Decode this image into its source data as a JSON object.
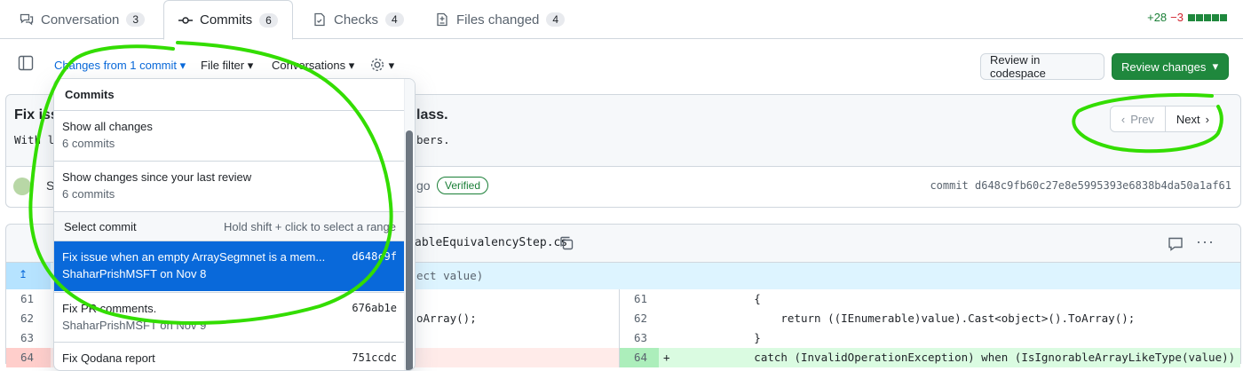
{
  "tabs": [
    {
      "label": "Conversation",
      "count": "3"
    },
    {
      "label": "Commits",
      "count": "6"
    },
    {
      "label": "Checks",
      "count": "4"
    },
    {
      "label": "Files changed",
      "count": "4"
    }
  ],
  "diffstat": {
    "additions": "+28",
    "deletions": "−3"
  },
  "toolbar": {
    "changes_prefix": "Changes from ",
    "changes_link": "1 commit",
    "file_filter": "File filter",
    "conversations": "Conversations",
    "review_codespace": "Review in codespace",
    "review_changes": "Review changes"
  },
  "commit_card": {
    "title_start": "Fix iss",
    "title_end": "lass.",
    "body_start": "With l",
    "body_end": "bers.",
    "author_initial": "S",
    "time_tail": "go",
    "verified": "Verified",
    "commit_sha": "commit d648c9fb60c27e8e5995393e6838b4da50a1af61",
    "prev": "Prev",
    "next": "Next"
  },
  "file_header": {
    "filename_tail": "ableEquivalencyStep.cs"
  },
  "diff": {
    "hunk_tail": "ect value)",
    "left_lines": [
      {
        "num": "61",
        "code": ""
      },
      {
        "num": "62",
        "code": "oArray();"
      },
      {
        "num": "63",
        "code": ""
      },
      {
        "num": "64",
        "code": ""
      }
    ],
    "right_lines": [
      {
        "num": "61",
        "marker": "",
        "code": "            {"
      },
      {
        "num": "62",
        "marker": "",
        "code": "                return ((IEnumerable)value).Cast<object>().ToArray();"
      },
      {
        "num": "63",
        "marker": "",
        "code": "            }"
      },
      {
        "num": "64",
        "marker": "+",
        "code": "            catch (InvalidOperationException) when (IsIgnorableArrayLikeType(value))"
      }
    ]
  },
  "dropdown": {
    "header": "Commits",
    "show_all_title": "Show all changes",
    "show_all_sub": "6 commits",
    "since_review_title": "Show changes since your last review",
    "since_review_sub": "6 commits",
    "select_label": "Select commit",
    "select_hint": "Hold shift + click to select a range",
    "commits": [
      {
        "title": "Fix issue when an empty ArraySegmnet is a mem...",
        "sha": "d648c9f",
        "sub": "ShaharPrishMSFT on Nov 8",
        "selected": true
      },
      {
        "title": "Fix PR comments.",
        "sha": "676ab1e",
        "sub": "ShaharPrishMSFT on Nov 9",
        "selected": false
      },
      {
        "title": "Fix Qodana report",
        "sha": "751ccdc",
        "sub": "",
        "selected": false
      }
    ]
  },
  "colors": {
    "accent": "#0969da",
    "green": "#1f883d",
    "annotation": "#33dd00",
    "selected": "#0969da"
  }
}
